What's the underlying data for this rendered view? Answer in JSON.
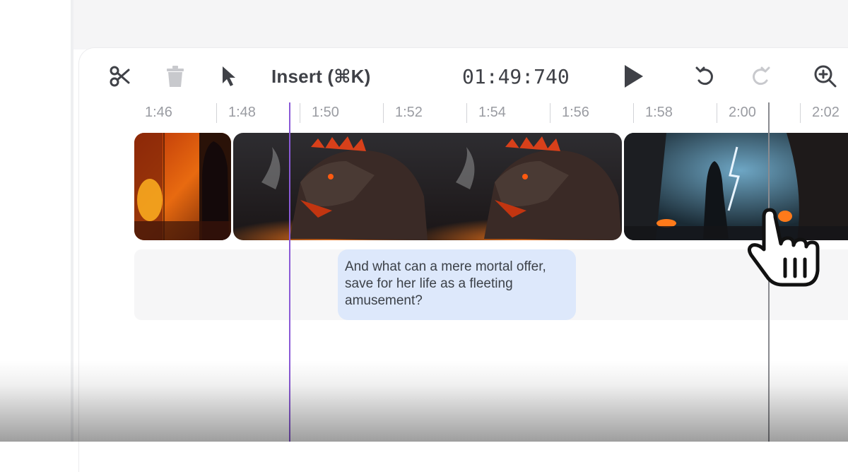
{
  "toolbar": {
    "icons": {
      "cut": "scissors-icon",
      "delete": "trash-icon",
      "select": "pointer-arrow-icon",
      "play": "play-icon",
      "undo": "undo-icon",
      "redo": "redo-icon",
      "zoom": "zoom-in-icon"
    },
    "insert_label": "Insert (⌘K)",
    "timecode": "01:49:740"
  },
  "timeline": {
    "ruler_labels": [
      "1:46",
      "1:48",
      "1:50",
      "1:52",
      "1:54",
      "1:56",
      "1:58",
      "2:00",
      "2:02"
    ],
    "playhead_time": "01:49:740",
    "video_clips": [
      {
        "name": "cave-fire-figure-clip",
        "scene": "figure in fiery cave"
      },
      {
        "name": "dragon-clip",
        "scene": "dragon breathing smoke"
      },
      {
        "name": "lightning-cave-clip",
        "scene": "woman in cave with lightning"
      }
    ],
    "subtitles": [
      {
        "text": "And what can a mere mortal offer, save for her life as a fleeting amusement?"
      }
    ]
  },
  "colors": {
    "accent_playhead": "#8a5ad6",
    "caption_bg": "#dde8fb",
    "toolbar_icon": "#3f4147",
    "disabled_icon": "#c8c9cd"
  }
}
